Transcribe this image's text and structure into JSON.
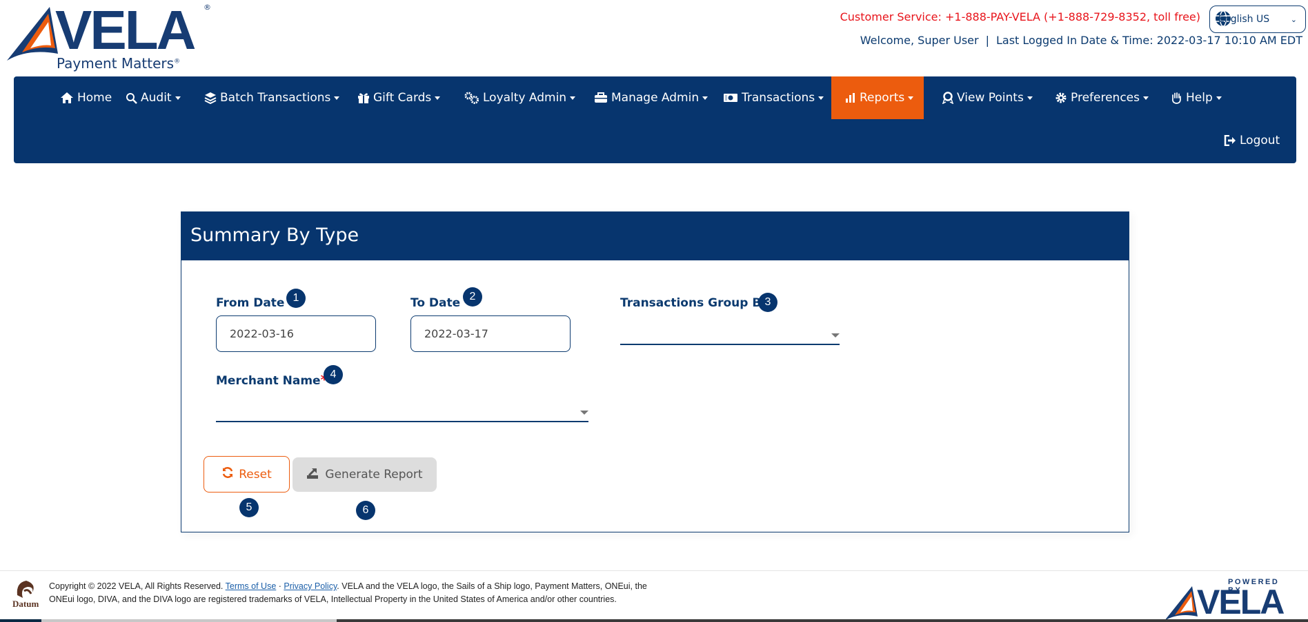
{
  "brand": {
    "name": "VELA",
    "tagline": "Payment Matters",
    "registered": "®",
    "colors": {
      "navy": "#07356e",
      "orange": "#ec5c0e",
      "red": "#e8141b"
    }
  },
  "header": {
    "customer_service": "Customer Service: +1-888-PAY-VELA (+1-888-729-8352, toll free)",
    "language": {
      "selected": "English US",
      "icon": "globe-icon"
    },
    "welcome": "Welcome, Super User",
    "separator": "|",
    "last_login": "Last Logged In Date & Time: 2022-03-17 10:10 AM EDT"
  },
  "nav": {
    "items": [
      {
        "label": "Home",
        "icon": "home-icon",
        "dropdown": false
      },
      {
        "label": "Audit",
        "icon": "audit-search-icon",
        "dropdown": true
      },
      {
        "label": "Batch Transactions",
        "icon": "layers-icon",
        "dropdown": true
      },
      {
        "label": "Gift Cards",
        "icon": "gift-icon",
        "dropdown": true
      },
      {
        "label": "Loyalty Admin",
        "icon": "cogs-icon",
        "dropdown": true
      },
      {
        "label": "Manage Admin",
        "icon": "toolbox-icon",
        "dropdown": true
      },
      {
        "label": "Transactions",
        "icon": "money-bill-icon",
        "dropdown": true
      },
      {
        "label": "Reports",
        "icon": "bar-chart-icon",
        "dropdown": true,
        "active": true
      },
      {
        "label": "View Points",
        "icon": "award-icon",
        "dropdown": true
      },
      {
        "label": "Preferences",
        "icon": "gear-icon",
        "dropdown": true
      },
      {
        "label": "Help",
        "icon": "hand-icon",
        "dropdown": true
      },
      {
        "label": "Logout",
        "icon": "logout-icon",
        "dropdown": false
      }
    ]
  },
  "form": {
    "title": "Summary By Type",
    "from_date": {
      "label": "From Date",
      "value": "2022-03-16",
      "badge": "1"
    },
    "to_date": {
      "label": "To Date",
      "value": "2022-03-17",
      "badge": "2"
    },
    "group_by": {
      "label": "Transactions Group By",
      "required": "*",
      "value": "",
      "badge": "3"
    },
    "merchant": {
      "label": "Merchant Name",
      "required": "*",
      "value": "",
      "badge": "4"
    },
    "reset": {
      "label": "Reset",
      "badge": "5",
      "icon": "refresh-icon"
    },
    "generate": {
      "label": "Generate Report",
      "badge": "6",
      "icon": "export-icon"
    }
  },
  "footer": {
    "datum_label": "Datum",
    "copyright": "Copyright © 2022 VELA, All Rights Reserved.",
    "terms": "Terms of Use",
    "dot": " · ",
    "privacy": "Privacy Policy",
    "trademark_1": ". VELA and the VELA logo, the Sails of a Ship logo, Payment Matters, ONEui, the",
    "trademark_2": "ONEui logo, DIVA, and the DIVA logo are registered trademarks of VELA, Intellectual Property in the United States of America and/or other countries.",
    "powered_by": "POWERED BY",
    "powered_brand": "VELA"
  }
}
